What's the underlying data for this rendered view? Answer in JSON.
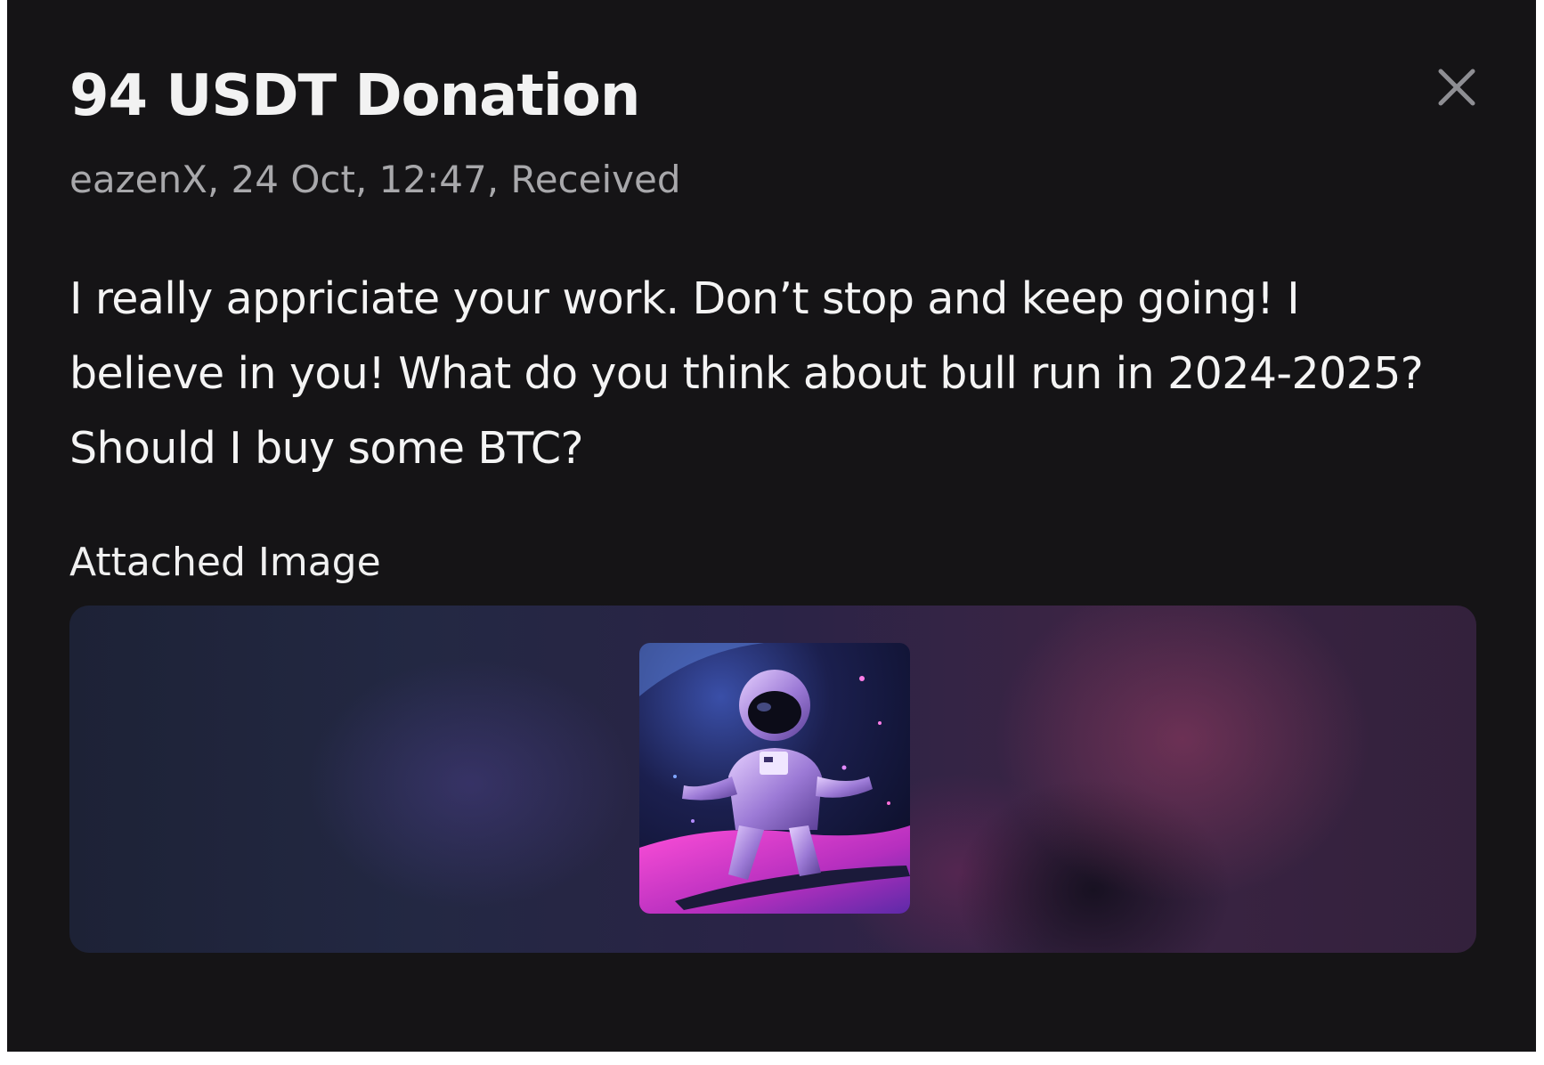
{
  "modal": {
    "title": "94 USDT Donation",
    "meta": "eazenX, 24 Oct, 12:47, Received",
    "message": "I really appriciate your work. Don’t stop and keep going! I believe in you! What do you think about bull run in 2024-2025? Should I buy some BTC?",
    "attached_label": "Attached Image",
    "close_icon": "close-icon",
    "attached_image_icon": "astronaut-image"
  },
  "colors": {
    "background": "#151416",
    "title": "#f2f2f2",
    "meta": "#a8a8ab",
    "close": "#8e8e93"
  }
}
